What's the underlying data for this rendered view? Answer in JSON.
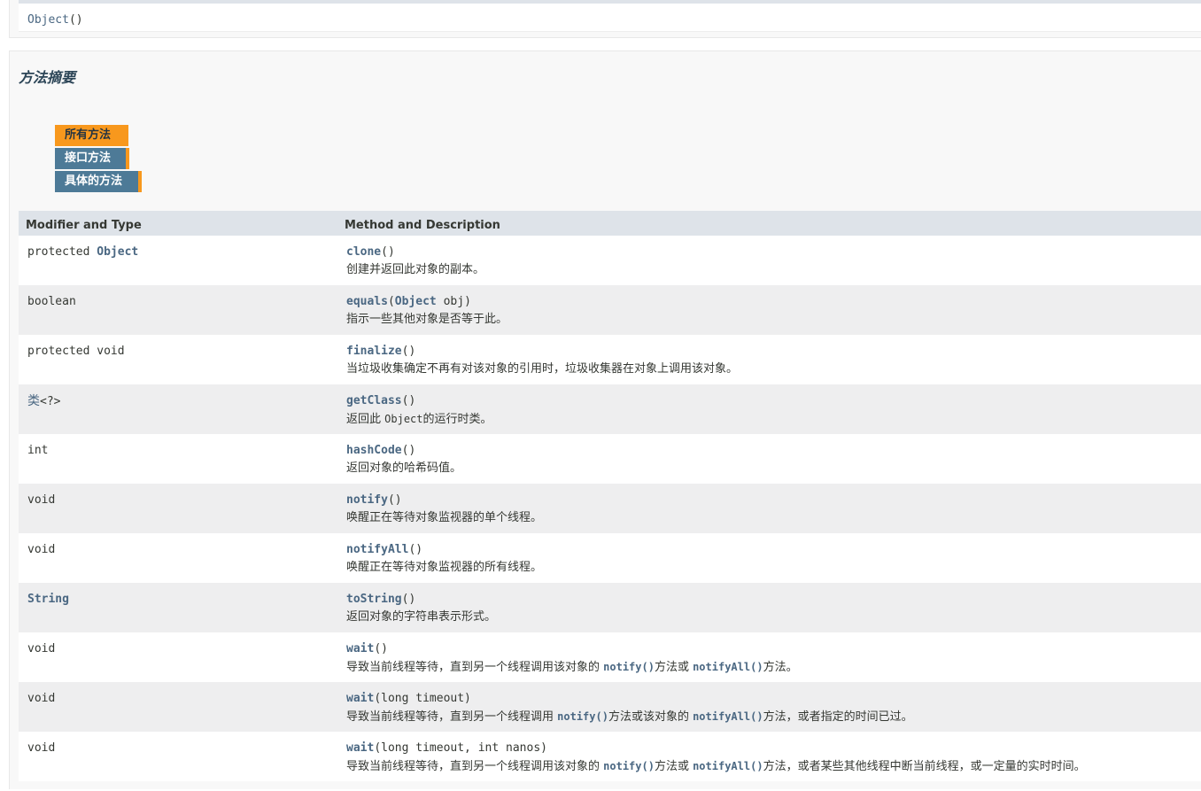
{
  "top_block": {
    "constructor": "Object",
    "parens": "()"
  },
  "summary": {
    "title": "方法摘要",
    "tabs": [
      {
        "label": "所有方法",
        "active": true
      },
      {
        "label": "接口方法",
        "active": false
      },
      {
        "label": "具体的方法",
        "active": false
      }
    ],
    "headers": {
      "col1": "Modifier and Type",
      "col2": "Method and Description"
    },
    "rows": [
      {
        "type_prefix": "protected ",
        "type_link": "Object",
        "type_suffix": "",
        "method": "clone",
        "params_pre": "()",
        "params_link": "",
        "params_post": "",
        "desc": [
          {
            "t": "创建并返回此对象的副本。"
          }
        ]
      },
      {
        "type_prefix": "boolean",
        "type_link": "",
        "type_suffix": "",
        "method": "equals",
        "params_pre": "(",
        "params_link": "Object",
        "params_post": " obj)",
        "desc": [
          {
            "t": "指示一些其他对象是否等于此。"
          }
        ]
      },
      {
        "type_prefix": "protected void",
        "type_link": "",
        "type_suffix": "",
        "method": "finalize",
        "params_pre": "()",
        "params_link": "",
        "params_post": "",
        "desc": [
          {
            "t": "当垃圾收集确定不再有对该对象的引用时，垃圾收集器在对象上调用该对象。"
          }
        ]
      },
      {
        "type_prefix": "",
        "type_link": "类",
        "type_suffix": "<?>",
        "method": "getClass",
        "params_pre": "()",
        "params_link": "",
        "params_post": "",
        "desc": [
          {
            "t": "返回此 "
          },
          {
            "t": "Object",
            "code": true
          },
          {
            "t": "的运行时类。"
          }
        ]
      },
      {
        "type_prefix": "int",
        "type_link": "",
        "type_suffix": "",
        "method": "hashCode",
        "params_pre": "()",
        "params_link": "",
        "params_post": "",
        "desc": [
          {
            "t": "返回对象的哈希码值。"
          }
        ]
      },
      {
        "type_prefix": "void",
        "type_link": "",
        "type_suffix": "",
        "method": "notify",
        "params_pre": "()",
        "params_link": "",
        "params_post": "",
        "desc": [
          {
            "t": "唤醒正在等待对象监视器的单个线程。"
          }
        ]
      },
      {
        "type_prefix": "void",
        "type_link": "",
        "type_suffix": "",
        "method": "notifyAll",
        "params_pre": "()",
        "params_link": "",
        "params_post": "",
        "desc": [
          {
            "t": "唤醒正在等待对象监视器的所有线程。"
          }
        ]
      },
      {
        "type_prefix": "",
        "type_link": "String",
        "type_suffix": "",
        "method": "toString",
        "params_pre": "()",
        "params_link": "",
        "params_post": "",
        "desc": [
          {
            "t": "返回对象的字符串表示形式。"
          }
        ]
      },
      {
        "type_prefix": "void",
        "type_link": "",
        "type_suffix": "",
        "method": "wait",
        "params_pre": "()",
        "params_link": "",
        "params_post": "",
        "desc": [
          {
            "t": "导致当前线程等待，直到另一个线程调用该对象的 "
          },
          {
            "t": "notify()",
            "link": true
          },
          {
            "t": "方法或 "
          },
          {
            "t": "notifyAll()",
            "link": true
          },
          {
            "t": "方法。"
          }
        ]
      },
      {
        "type_prefix": "void",
        "type_link": "",
        "type_suffix": "",
        "method": "wait",
        "params_pre": "(long timeout)",
        "params_link": "",
        "params_post": "",
        "desc": [
          {
            "t": "导致当前线程等待，直到另一个线程调用 "
          },
          {
            "t": "notify()",
            "link": true
          },
          {
            "t": "方法或该对象的 "
          },
          {
            "t": "notifyAll()",
            "link": true
          },
          {
            "t": "方法，或者指定的时间已过。"
          }
        ]
      },
      {
        "type_prefix": "void",
        "type_link": "",
        "type_suffix": "",
        "method": "wait",
        "params_pre": "(long timeout, int nanos)",
        "params_link": "",
        "params_post": "",
        "desc": [
          {
            "t": "导致当前线程等待，直到另一个线程调用该对象的 "
          },
          {
            "t": "notify()",
            "link": true
          },
          {
            "t": "方法或 "
          },
          {
            "t": "notifyAll()",
            "link": true
          },
          {
            "t": "方法，或者某些其他线程中断当前线程，或一定量的实时时间。"
          }
        ]
      }
    ]
  },
  "colors": {
    "link": "#4a6782",
    "tab_active": "#f8981d",
    "tab_inactive": "#4d7a97",
    "header_bg": "#dee3e9",
    "row_alt": "#eeeeef"
  }
}
